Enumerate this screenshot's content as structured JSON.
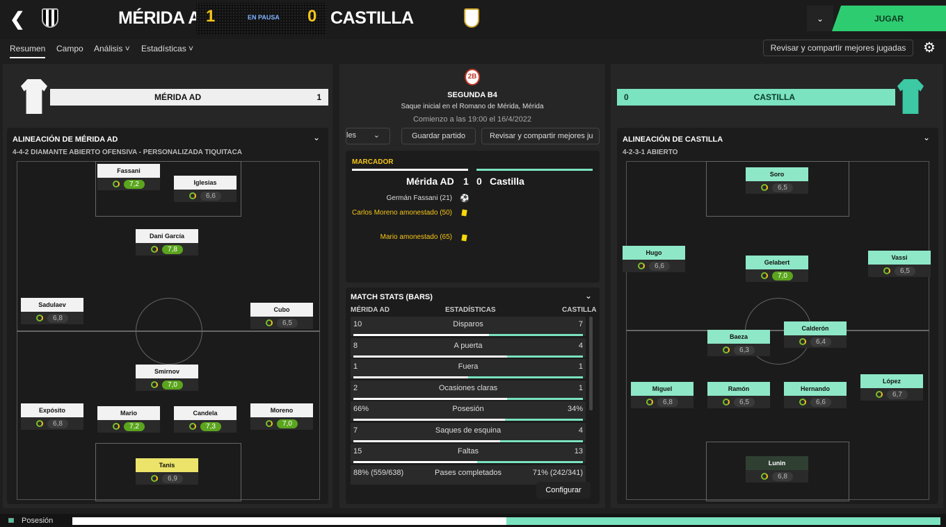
{
  "header": {
    "home": "MÉRIDA AD",
    "away": "CASTILLA",
    "home_score": "1",
    "away_score": "0",
    "status": "EN PAUSA",
    "play": "JUGAR"
  },
  "tabs": [
    "Resumen",
    "Campo",
    "Análisis",
    "Estadísticas"
  ],
  "share": "Revisar y compartir mejores jugadas",
  "home_banner": {
    "name": "MÉRIDA AD",
    "score": "1"
  },
  "away_banner": {
    "name": "CASTILLA",
    "score": "0"
  },
  "match": {
    "comp": "SEGUNDA B4",
    "venue": "Saque inicial en el Romano de Mérida, Mérida",
    "start": "Comienzo a las 19:00 el 16/4/2022",
    "mid_trunc": "les",
    "save": "Guardar partido",
    "share_trunc": "Revisar y compartir mejores ju"
  },
  "scoreboard": {
    "label": "MARCADOR",
    "line_home": "Mérida AD",
    "s1": "1",
    "s2": "0",
    "line_away": "Castilla",
    "events": [
      "Germán Fassani (21)",
      "Carlos Moreno amonestado (50)",
      "Mario amonestado (65)"
    ]
  },
  "home_lineup": {
    "title": "ALINEACIÓN DE MÉRIDA AD",
    "formation": "4-4-2 DIAMANTE ABIERTO OFENSIVA - PERSONALIZADA TIQUITACA",
    "players": [
      {
        "n": "Fassani",
        "r": "7,2",
        "g": true
      },
      {
        "n": "Iglesias",
        "r": "6,6"
      },
      {
        "n": "Dani García",
        "r": "7,8",
        "g": true
      },
      {
        "n": "Sadulaev",
        "r": "6,8"
      },
      {
        "n": "Cubo",
        "r": "6,5"
      },
      {
        "n": "Smirnov",
        "r": "7,0",
        "g": true
      },
      {
        "n": "Expósito",
        "r": "6,8"
      },
      {
        "n": "Mario",
        "r": "7,2",
        "g": true
      },
      {
        "n": "Candela",
        "r": "7,3",
        "g": true
      },
      {
        "n": "Moreno",
        "r": "7,0",
        "g": true
      },
      {
        "n": "Tanis",
        "r": "6,9"
      }
    ]
  },
  "away_lineup": {
    "title": "ALINEACIÓN DE CASTILLA",
    "formation": "4-2-3-1 ABIERTO",
    "players": [
      {
        "n": "Soro",
        "r": "6,5"
      },
      {
        "n": "Hugo",
        "r": "6,6"
      },
      {
        "n": "Gelabert",
        "r": "7,0",
        "g": true
      },
      {
        "n": "Vassi",
        "r": "6,5"
      },
      {
        "n": "Baeza",
        "r": "6,3"
      },
      {
        "n": "Calderón",
        "r": "6,4"
      },
      {
        "n": "Miguel",
        "r": "6,8"
      },
      {
        "n": "Ramón",
        "r": "6,5"
      },
      {
        "n": "Hernando",
        "r": "6,6"
      },
      {
        "n": "López",
        "r": "6,7"
      },
      {
        "n": "Lunin",
        "r": "6,8"
      }
    ]
  },
  "stats": {
    "title": "MATCH STATS (BARS)",
    "h_home": "MÉRIDA AD",
    "h_mid": "ESTADÍSTICAS",
    "h_away": "CASTILLA",
    "config": "Configurar",
    "rows": [
      {
        "l": "10",
        "m": "Disparos",
        "r": "7",
        "f": 0.59
      },
      {
        "l": "8",
        "m": "A puerta",
        "r": "4",
        "f": 0.67
      },
      {
        "l": "1",
        "m": "Fuera",
        "r": "1",
        "f": 0.5
      },
      {
        "l": "2",
        "m": "Ocasiones claras",
        "r": "1",
        "f": 0.67
      },
      {
        "l": "66%",
        "m": "Posesión",
        "r": "34%",
        "f": 0.66
      },
      {
        "l": "7",
        "m": "Saques de esquina",
        "r": "4",
        "f": 0.64
      },
      {
        "l": "15",
        "m": "Faltas",
        "r": "13",
        "f": 0.54
      },
      {
        "l": "88% (559/638)",
        "m": "Pases completados",
        "r": "71% (242/341)",
        "f": 0
      }
    ]
  },
  "possession": {
    "label": "Posesión",
    "home": 0.66
  }
}
